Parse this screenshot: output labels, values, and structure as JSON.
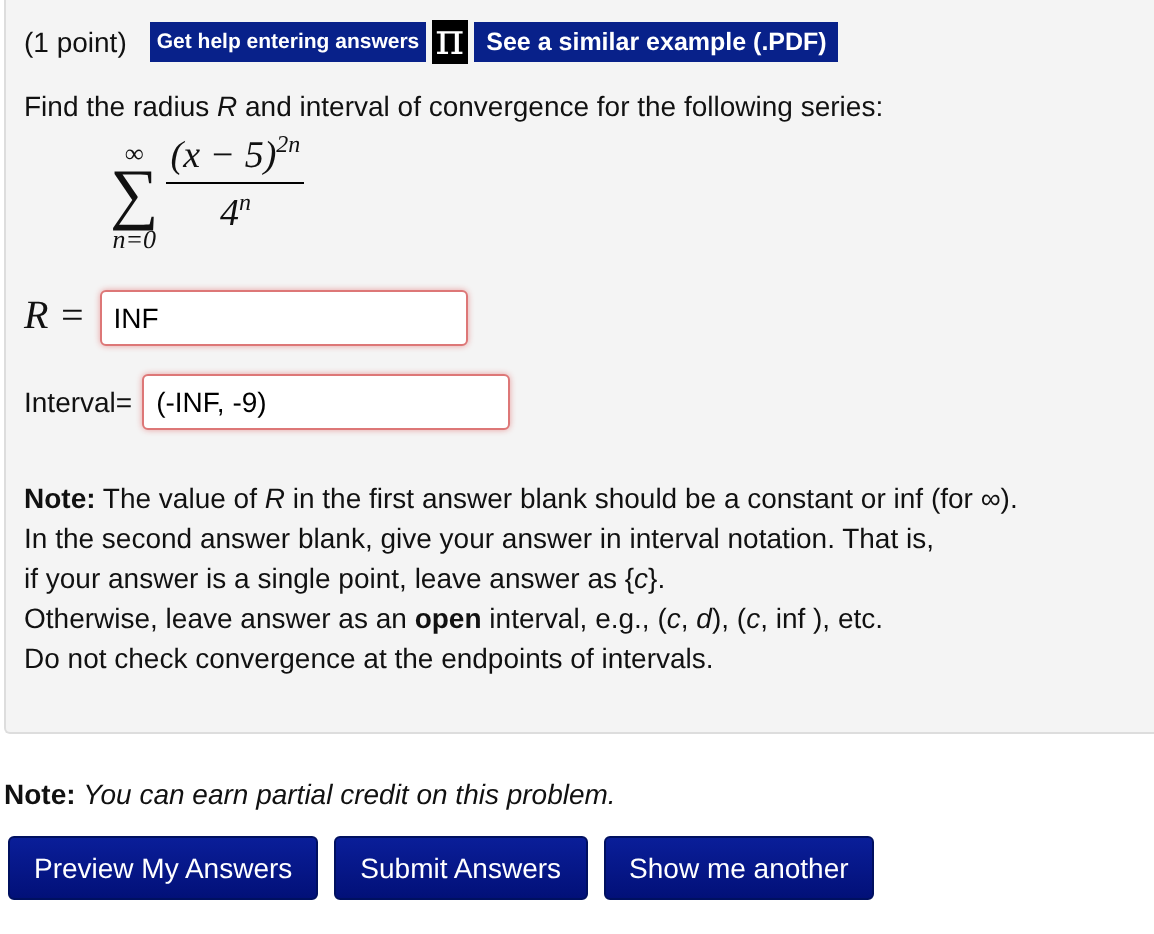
{
  "problem": {
    "points": "(1 point)",
    "help_link": "Get help entering answers",
    "pi_link": "π",
    "example_link": "See a similar example (.PDF)",
    "question": "Find the radius *R* and interval of convergence for the following series:",
    "series": {
      "symbol": "∑",
      "upper": "∞",
      "lower": "n=0",
      "numerator": "(x − 5)$^{2n}$",
      "denominator": "4$^{n}$"
    },
    "answers": [
      {
        "label": "R =",
        "kind": "math",
        "value": "INF",
        "incorrect": true
      },
      {
        "label": "Interval=",
        "kind": "text",
        "value": "(-INF, -9)",
        "incorrect": true
      }
    ],
    "notes": [
      "**Note:** The value of *R* in the first answer blank should be a constant or inf (for ∞).",
      "In the second answer blank, give your answer in interval notation. That is,",
      "if your answer is a single point, leave answer as {*c*}.",
      "Otherwise, leave answer as an **open** interval, e.g.,  (*c*, *d*),  (*c*, inf ), etc.",
      "Do not check convergence at the endpoints of intervals."
    ]
  },
  "credit_note": "**Note:** *You can earn partial credit on this problem.*",
  "buttons": [
    "Preview My Answers",
    "Submit Answers",
    "Show me another"
  ]
}
